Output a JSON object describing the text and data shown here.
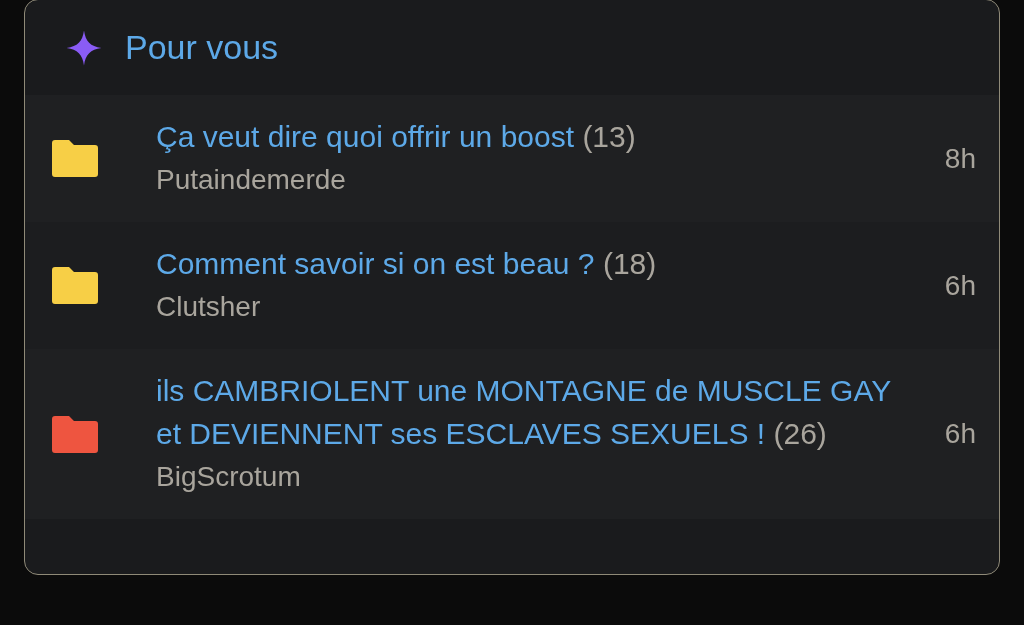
{
  "section": {
    "title": "Pour vous"
  },
  "topics": [
    {
      "title": "Ça veut dire quoi offrir un boost",
      "count": "(13)",
      "author": "Putaindemerde",
      "time": "8h",
      "color": "#f7cf46"
    },
    {
      "title": "Comment savoir si on est beau ?",
      "count": "(18)",
      "author": "Clutsher",
      "time": "6h",
      "color": "#f7cf46"
    },
    {
      "title": "ils CAMBRIOLENT une MONTAGNE de MUSCLE GAY et DEVIENNENT ses ESCLAVES SEXUELS !",
      "count": "(26)",
      "author": "BigScrotum",
      "time": "6h",
      "color": "#ee5540"
    }
  ]
}
